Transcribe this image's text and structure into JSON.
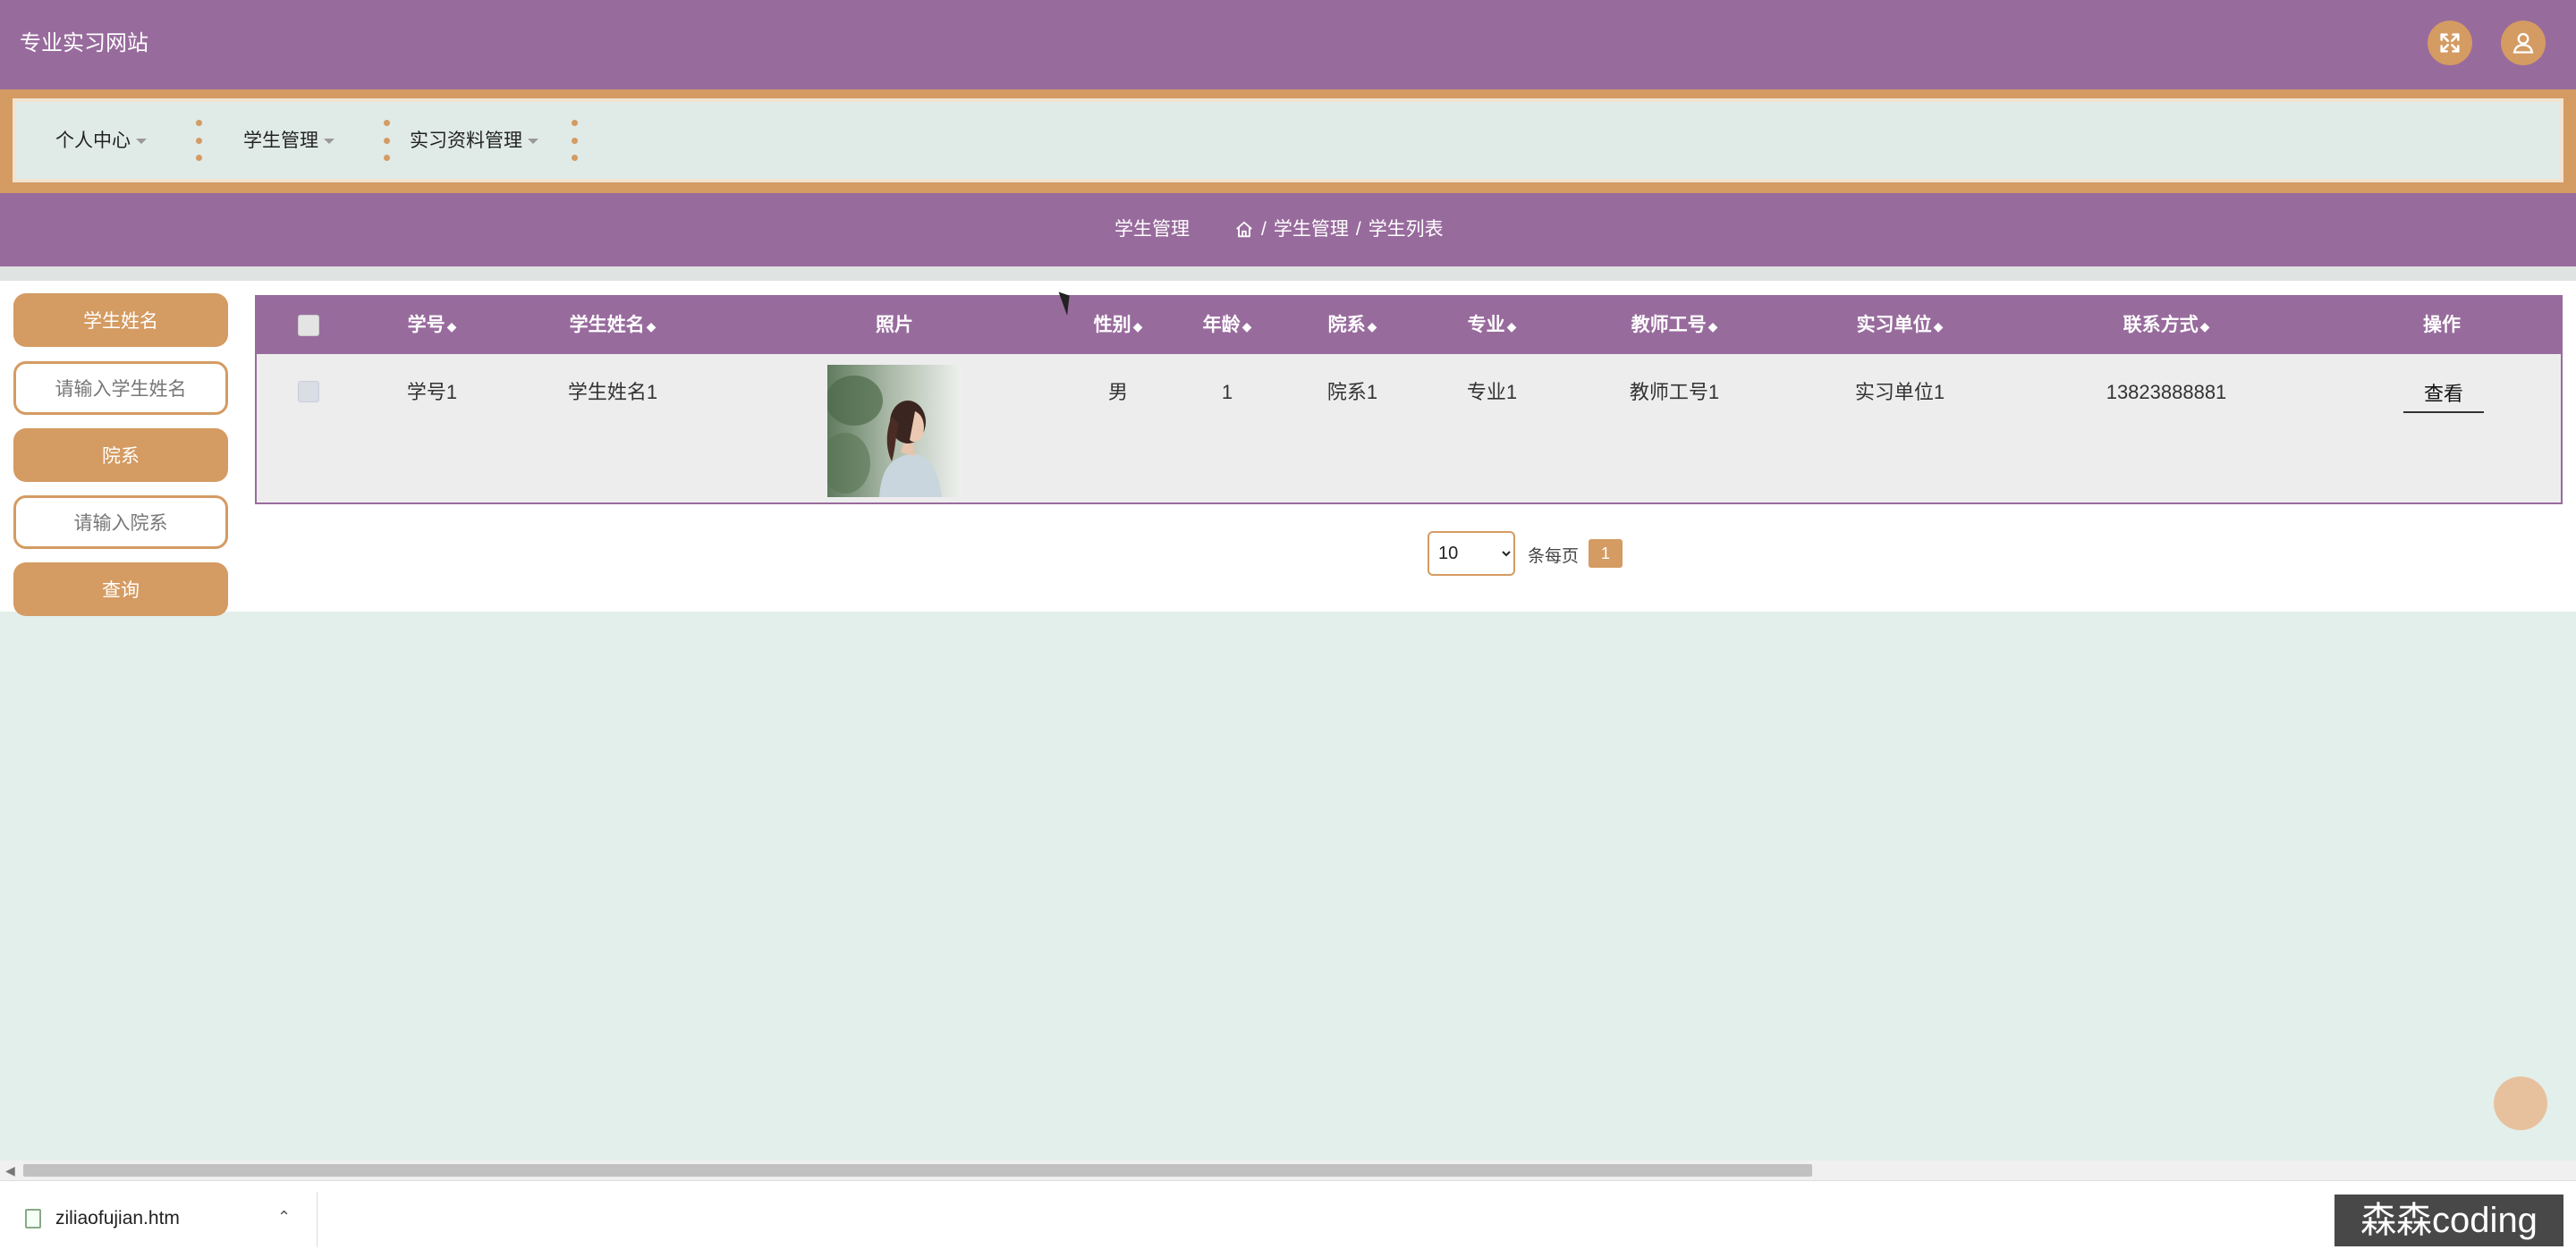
{
  "header": {
    "site_title": "专业实习网站"
  },
  "nav": {
    "items": [
      {
        "label": "个人中心"
      },
      {
        "label": "学生管理"
      },
      {
        "label": "实习资料管理"
      }
    ]
  },
  "breadcrumb": {
    "title": "学生管理",
    "path": [
      "学生管理",
      "学生列表"
    ],
    "sep": "/"
  },
  "search": {
    "name_label": "学生姓名",
    "name_placeholder": "请输入学生姓名",
    "dept_label": "院系",
    "dept_placeholder": "请输入院系",
    "query_label": "查询"
  },
  "table": {
    "columns": [
      "学号",
      "学生姓名",
      "照片",
      "性别",
      "年龄",
      "院系",
      "专业",
      "教师工号",
      "实习单位",
      "联系方式",
      "操作"
    ],
    "sort_glyph": "◆",
    "rows": [
      {
        "student_no": "学号1",
        "student_name": "学生姓名1",
        "gender": "男",
        "age": "1",
        "department": "院系1",
        "major": "专业1",
        "teacher_no": "教师工号1",
        "company": "实习单位1",
        "phone": "13823888881",
        "action": "查看"
      }
    ]
  },
  "pagination": {
    "page_size": "10",
    "page_size_options": [
      "10"
    ],
    "per_page_label": "条每页",
    "current_page": "1"
  },
  "download_bar": {
    "file_name": "ziliaofujian.htm"
  },
  "watermark": "森森coding",
  "colors": {
    "primary_purple": "#986b9d",
    "accent_orange": "#d49b62",
    "background": "#e3efeb"
  }
}
